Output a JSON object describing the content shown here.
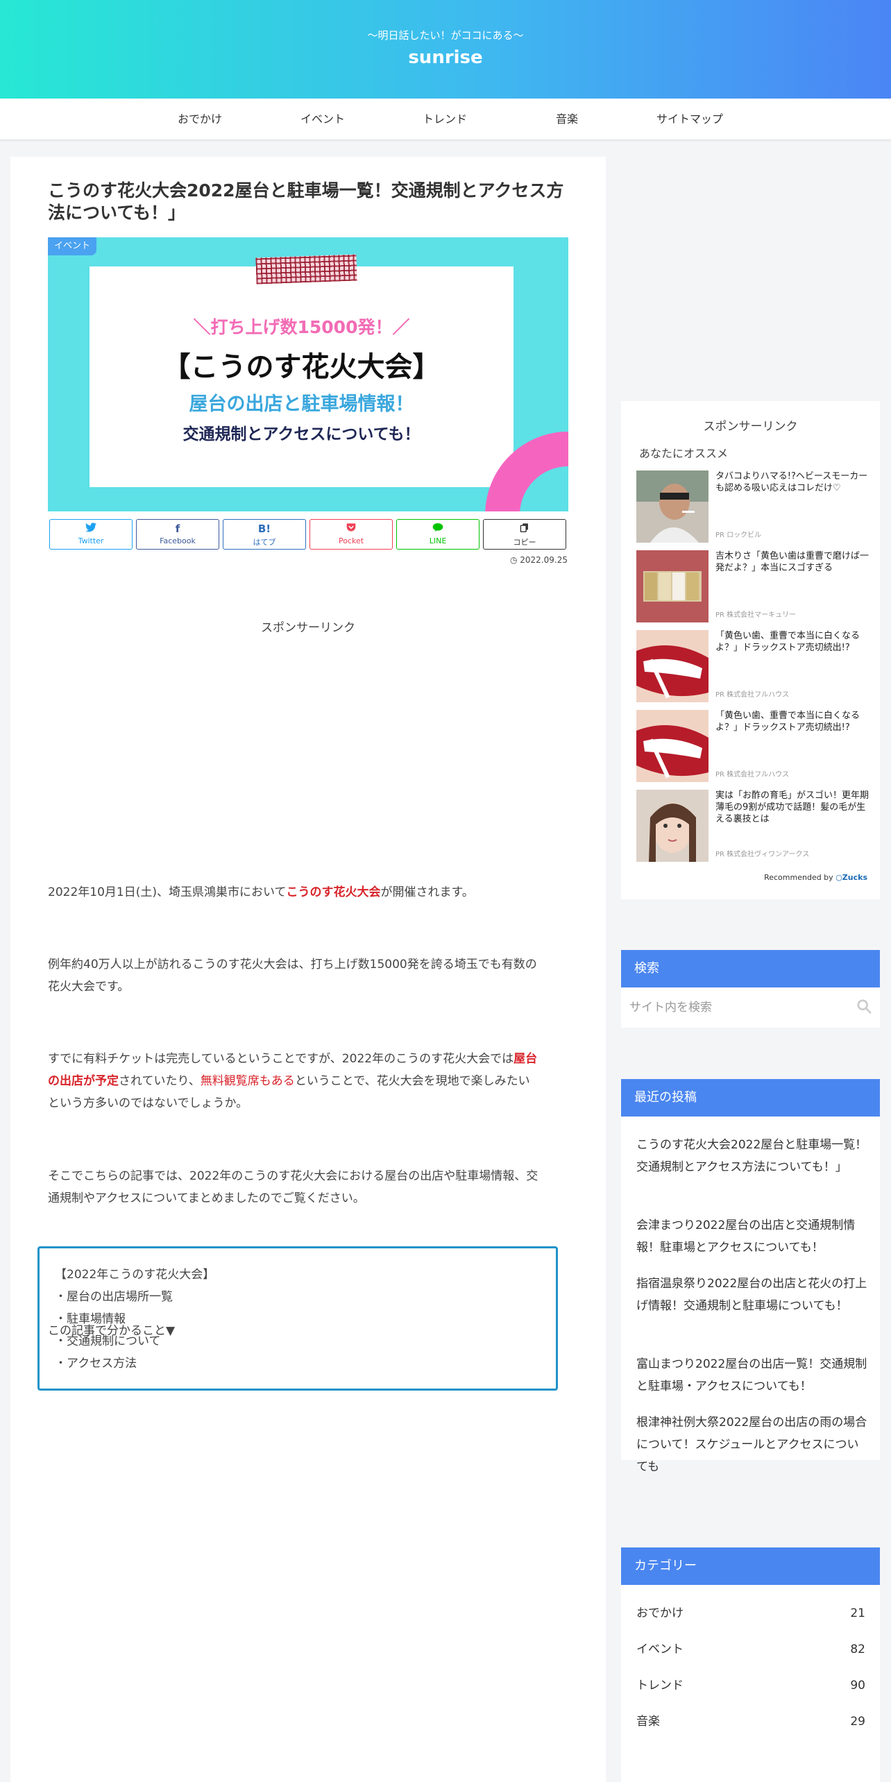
{
  "header": {
    "tagline": "～明日話したい！がココにある～",
    "site_title": "sunrise",
    "gradient": [
      "#27e8d4",
      "#4b85f5"
    ]
  },
  "nav": {
    "items": [
      "おでかけ",
      "イベント",
      "トレンド",
      "音楽",
      "サイトマップ"
    ]
  },
  "article": {
    "title": "こうのす花火大会2022屋台と駐車場一覧！交通規制とアクセス方法についても！」",
    "category_label": "イベント",
    "eyecatch": {
      "line1": "＼打ち上げ数15000発！／",
      "line2": "【こうのす花火大会】",
      "line3": "屋台の出店と駐車場情報！",
      "line4": "交通規制とアクセスについても！"
    },
    "share": [
      {
        "icon": "twitter-icon",
        "glyph": "🐦",
        "label": "Twitter",
        "color": "#1da1f2"
      },
      {
        "icon": "facebook-icon",
        "glyph": "f",
        "label": "Facebook",
        "color": "#3b5998"
      },
      {
        "icon": "hatebu-icon",
        "glyph": "B!",
        "label": "はてブ",
        "color": "#2c6ebd"
      },
      {
        "icon": "pocket-icon",
        "glyph": "◗",
        "label": "Pocket",
        "color": "#ef4056"
      },
      {
        "icon": "line-icon",
        "glyph": "◉",
        "label": "LINE",
        "color": "#00c300"
      },
      {
        "icon": "copy-icon",
        "glyph": "❐",
        "label": "コピー",
        "color": "#333333"
      }
    ],
    "date": "2022.09.25",
    "sponsor_label": "スポンサーリンク",
    "p1": {
      "a": "2022年10月1日(土)、埼玉県鴻巣市において",
      "b": "こうのす花火大会",
      "c": "が開催されます。"
    },
    "p2": {
      "line1": "例年約40万人以上が訪れるこうのす花火大会は、打ち上げ数15000発を誇る埼玉でも有数の",
      "line2": "花火大会です。"
    },
    "p3": {
      "a": "すでに有料チケットは完売しているということですが、2022年のこうのす花火大会では",
      "b": "屋台",
      "c": "の出店が予定",
      "d": "されていたり、",
      "e": "無料観覧席もある",
      "f": "ということで、花火大会を現地で楽しみたい",
      "g": "という方多いのではないでしょうか。"
    },
    "p4": {
      "line1": "そこでこちらの記事では、2022年のこうのす花火大会における屋台の出店や駐車場情報、交",
      "line2": "通規制やアクセスについてまとめましたのでご覧ください。"
    },
    "toc_intro": "この記事で分かること▼",
    "toc": [
      "【2022年こうのす花火大会】",
      "・屋台の出店場所一覧",
      "・駐車場情報",
      "・交通規制について",
      "・アクセス方法"
    ]
  },
  "sidebar": {
    "sponsor_label": "スポンサーリンク",
    "recommend_title": "あなたにオススメ",
    "recommend": [
      {
        "title": "タバコよりハマる!?ヘビースモーカーも認める吸い応えはコレだけ♡",
        "pr": "PR ロックビル"
      },
      {
        "title": "吉木りさ「黄色い歯は重曹で磨けば一発だよ？」本当にスゴすぎる",
        "pr": "PR 株式会社マーキュリー"
      },
      {
        "title": "「黄色い歯、重曹で本当に白くなるよ？」ドラックストア売切続出!?",
        "pr": "PR 株式会社フルハウス"
      },
      {
        "title": "「黄色い歯、重曹で本当に白くなるよ？」ドラックストア売切続出!?",
        "pr": "PR 株式会社フルハウス"
      },
      {
        "title": "実は「お酢の育毛」がスゴい！更年期薄毛の9割が成功で話題！髪の毛が生える裏技とは",
        "pr": "PR 株式会社ヴィワンアークス"
      }
    ],
    "recommended_by": "Recommended by",
    "zucks": "Zucks",
    "search": {
      "heading": "検索",
      "placeholder": "サイト内を検索"
    },
    "recent": {
      "heading": "最近の投稿",
      "items": [
        "こうのす花火大会2022屋台と駐車場一覧！交通規制とアクセス方法についても！」",
        "会津まつり2022屋台の出店と交通規制情報！駐車場とアクセスについても！",
        "指宿温泉祭り2022屋台の出店と花火の打上げ情報！交通規制と駐車場についても！",
        "富山まつり2022屋台の出店一覧！交通規制と駐車場・アクセスについても！",
        "根津神社例大祭2022屋台の出店の雨の場合について！スケジュールとアクセスについても"
      ]
    },
    "categories": {
      "heading": "カテゴリー",
      "items": [
        {
          "name": "おでかけ",
          "count": "21"
        },
        {
          "name": "イベント",
          "count": "82"
        },
        {
          "name": "トレンド",
          "count": "90"
        },
        {
          "name": "音楽",
          "count": "29"
        }
      ]
    }
  }
}
